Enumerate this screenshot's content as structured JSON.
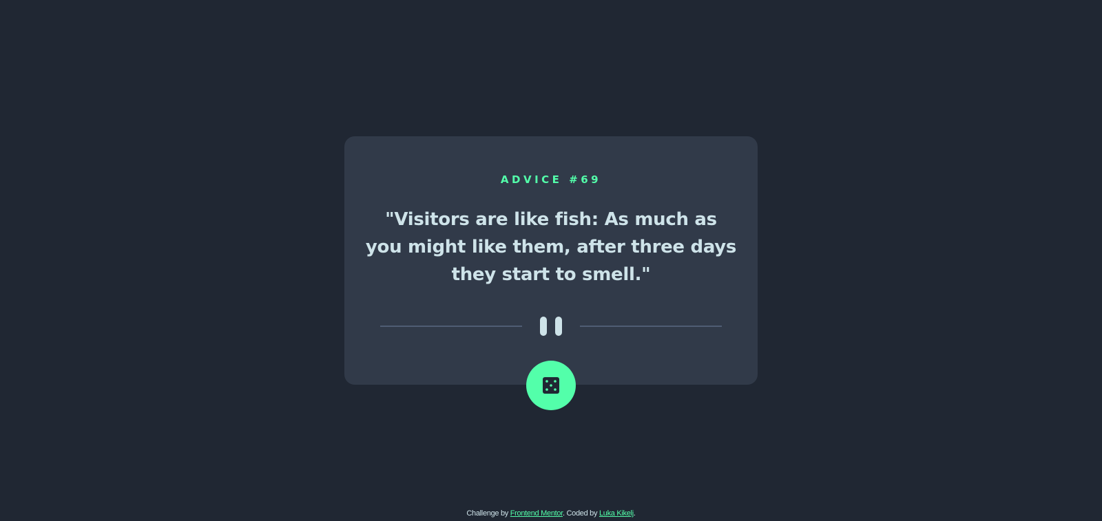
{
  "card": {
    "advice_label": "ADVICE #69",
    "advice_text": "\"Visitors are like fish: As much as you might like them, after three days they start to smell.\""
  },
  "divider": {
    "icon": "pause-icon"
  },
  "action": {
    "icon": "dice-icon"
  },
  "footer": {
    "prefix": "Challenge by ",
    "link1": "Frontend Mentor",
    "middle": ". Coded by ",
    "link2": "Luka Kikelj",
    "suffix": "."
  },
  "colors": {
    "background": "#202733",
    "card": "#313a49",
    "accent": "#53ffaa",
    "text": "#cee3e9",
    "divider": "#4f5d74"
  }
}
